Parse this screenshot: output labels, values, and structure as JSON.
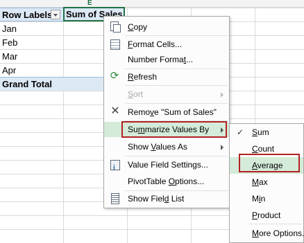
{
  "sheet": {
    "column_indicator": "E",
    "header": {
      "row_labels": "Row Labels",
      "value_field": "Sum of Sales"
    },
    "rows": [
      "Jan",
      "Feb",
      "Mar",
      "Apr"
    ],
    "grand_total": "Grand Total"
  },
  "context_menu": {
    "items": [
      {
        "label_pre": "",
        "label_ul": "C",
        "label_post": "opy",
        "icon": "copy-icon"
      },
      {
        "label_pre": "",
        "label_ul": "F",
        "label_post": "ormat Cells...",
        "icon": "format-cells-icon"
      },
      {
        "label_pre": "Number Forma",
        "label_ul": "t",
        "label_post": "...",
        "icon": ""
      },
      {
        "label_pre": "",
        "label_ul": "R",
        "label_post": "efresh",
        "icon": "refresh-icon"
      },
      {
        "label_pre": "",
        "label_ul": "S",
        "label_post": "ort",
        "icon": ""
      },
      {
        "label_pre": "Remo",
        "label_ul": "v",
        "label_post": "e \"Sum of Sales\"",
        "icon": "remove-icon"
      },
      {
        "label_pre": "Su",
        "label_ul": "m",
        "label_post": "marize Values By",
        "icon": ""
      },
      {
        "label_pre": "Show ",
        "label_ul": "V",
        "label_post": "alues As",
        "icon": ""
      },
      {
        "label_pre": "Value Field Settings",
        "label_ul": "",
        "label_post": "...",
        "icon": "value-field-settings-icon"
      },
      {
        "label_pre": "PivotTable ",
        "label_ul": "O",
        "label_post": "ptions...",
        "icon": ""
      },
      {
        "label_pre": "Show Fiel",
        "label_ul": "d",
        "label_post": " List",
        "icon": "field-list-icon"
      }
    ]
  },
  "summarize_submenu": {
    "checked_item": "Sum",
    "items": [
      {
        "label_pre": "",
        "label_ul": "S",
        "label_post": "um"
      },
      {
        "label_pre": "",
        "label_ul": "C",
        "label_post": "ount"
      },
      {
        "label_pre": "",
        "label_ul": "A",
        "label_post": "verage"
      },
      {
        "label_pre": "",
        "label_ul": "M",
        "label_post": "ax"
      },
      {
        "label_pre": "M",
        "label_ul": "i",
        "label_post": "n"
      },
      {
        "label_pre": "",
        "label_ul": "P",
        "label_post": "roduct"
      },
      {
        "label_pre": "",
        "label_ul": "M",
        "label_post": "ore Options..."
      }
    ]
  },
  "colors": {
    "pivot_header_bg": "#dde8f5",
    "menu_hover_bg": "#d5ebd9",
    "highlight_border": "#b22222",
    "selection_border": "#217346"
  }
}
